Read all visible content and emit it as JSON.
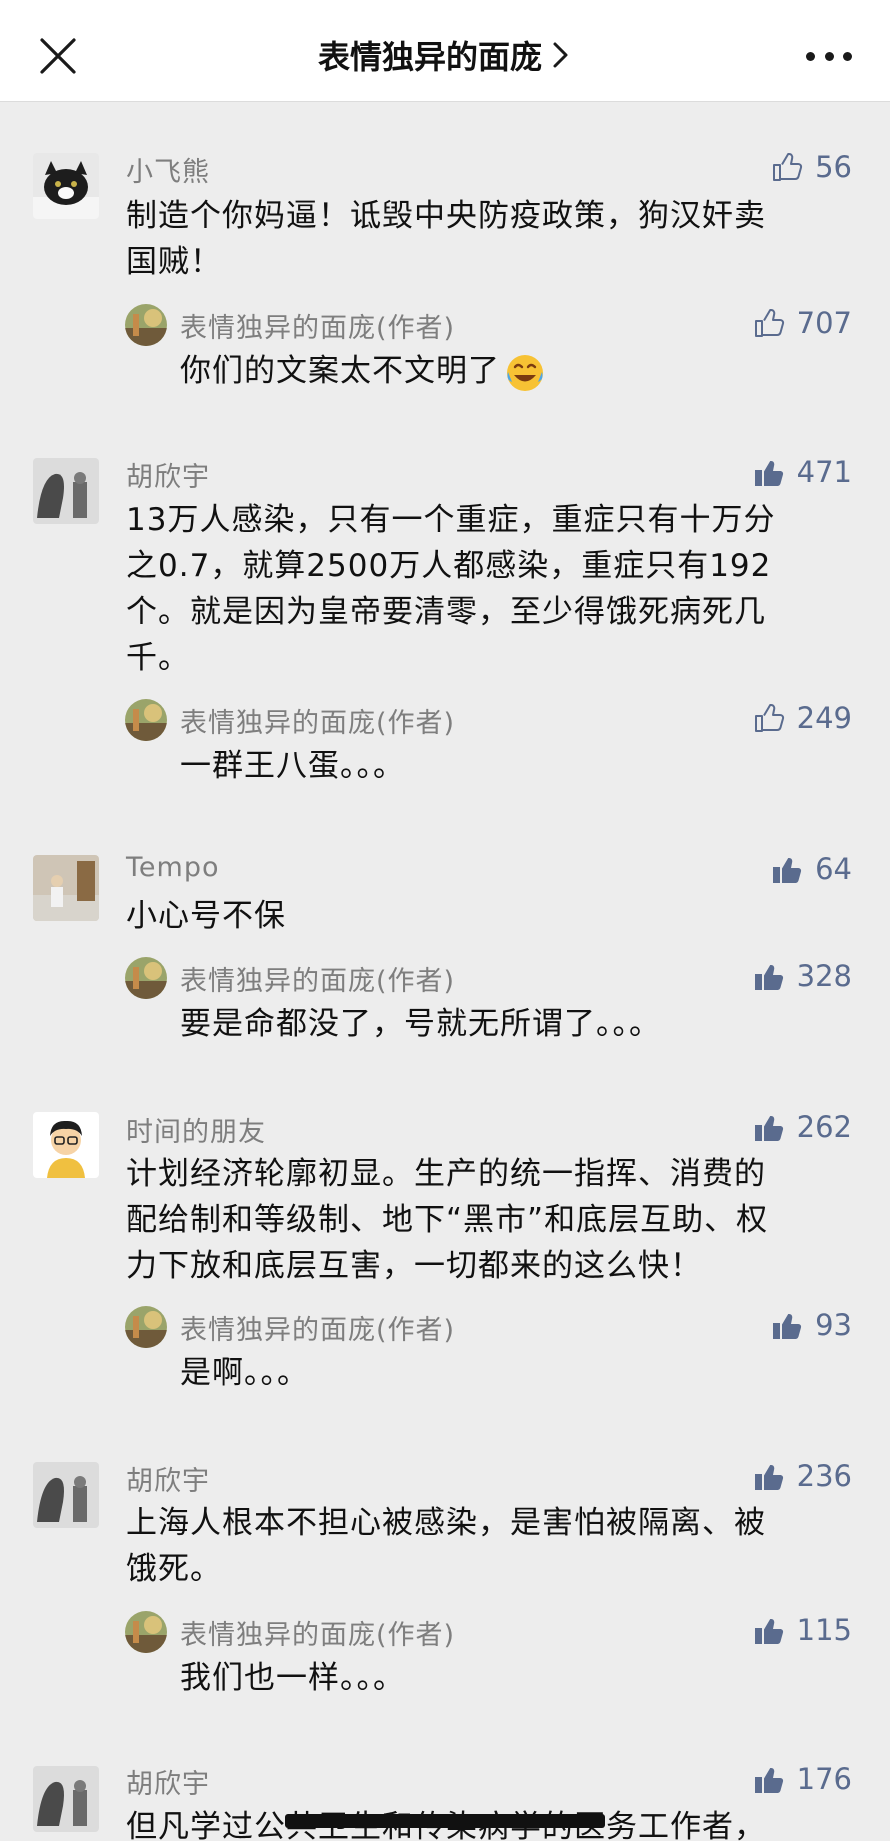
{
  "header": {
    "title": "表情独异的面庞",
    "close_icon": "close-icon",
    "more_icon": "more-icon"
  },
  "colors": {
    "like_blue": "#5a6b8e",
    "name_gray": "#7e7e7e",
    "bg": "#ededed"
  },
  "comments": [
    {
      "name": "小飞熊",
      "likes": "56",
      "liked": false,
      "text_lines": [
        "制造个你妈逼！诋毁中央防疫政策，狗汉奸卖",
        "国贼！"
      ],
      "reply": {
        "name": "表情独异的面庞(作者)",
        "likes": "707",
        "liked": false,
        "text": "你们的文案太不文明了",
        "emoji": "laughing-crying-emoji"
      }
    },
    {
      "name": "胡欣宇",
      "likes": "471",
      "liked": true,
      "text_lines": [
        "13万人感染，只有一个重症，重症只有十万分",
        "之0.7，就算2500万人都感染，重症只有192",
        "个。就是因为皇帝要清零，至少得饿死病死几",
        "千。"
      ],
      "reply": {
        "name": "表情独异的面庞(作者)",
        "likes": "249",
        "liked": false,
        "text": "一群王八蛋。。。"
      }
    },
    {
      "name": "Tempo",
      "likes": "64",
      "liked": true,
      "text_lines": [
        "小心号不保"
      ],
      "reply": {
        "name": "表情独异的面庞(作者)",
        "likes": "328",
        "liked": true,
        "text": "要是命都没了，号就无所谓了。。。"
      }
    },
    {
      "name": "时间的朋友",
      "likes": "262",
      "liked": true,
      "text_lines": [
        "计划经济轮廓初显。生产的统一指挥、消费的",
        "配给制和等级制、地下“黑市”和底层互助、权",
        "力下放和底层互害，一切都来的这么快！"
      ],
      "reply": {
        "name": "表情独异的面庞(作者)",
        "likes": "93",
        "liked": true,
        "text": "是啊。。。"
      }
    },
    {
      "name": "胡欣宇",
      "likes": "236",
      "liked": true,
      "text_lines": [
        "上海人根本不担心被感染，是害怕被隔离、被",
        "饿死。"
      ],
      "reply": {
        "name": "表情独异的面庞(作者)",
        "likes": "115",
        "liked": true,
        "text": "我们也一样。。。"
      }
    },
    {
      "name": "胡欣宇",
      "likes": "176",
      "liked": true,
      "text_lines": [
        "但凡学过公共卫生和传染病学的医务工作者，"
      ]
    }
  ]
}
